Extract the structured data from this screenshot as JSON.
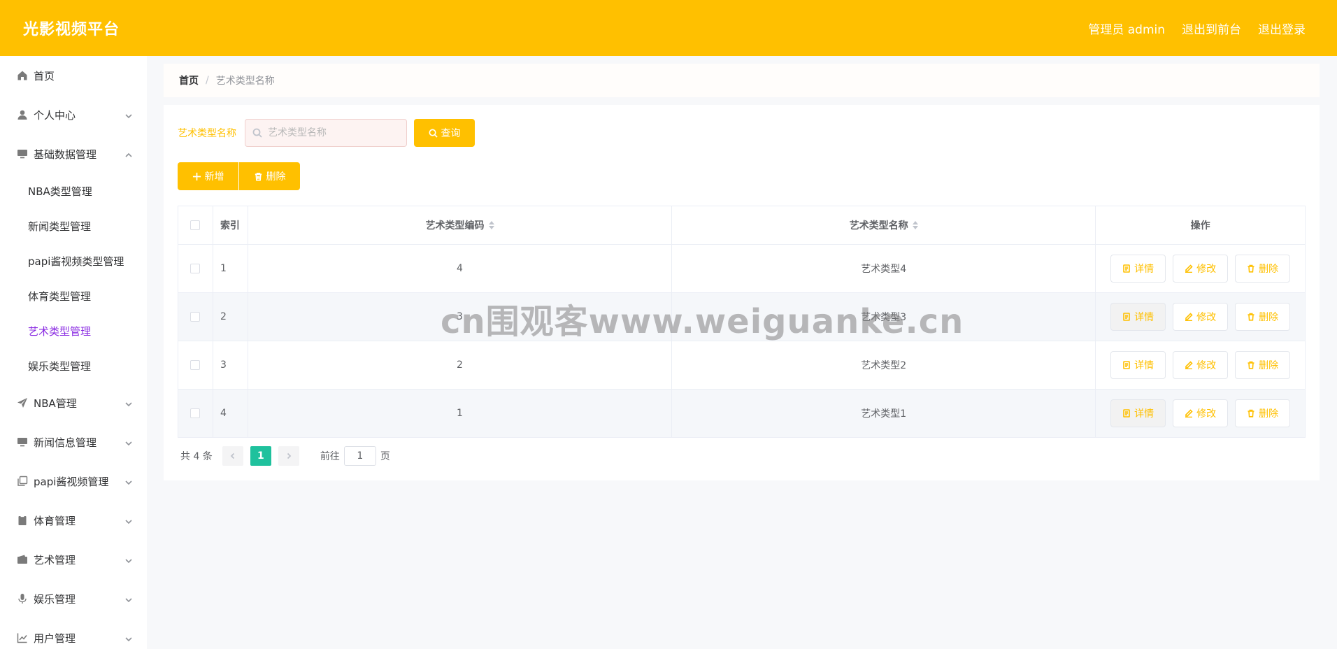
{
  "header": {
    "brand": "光影视频平台",
    "admin_label": "管理员 admin",
    "front_label": "退出到前台",
    "logout_label": "退出登录"
  },
  "sidebar": {
    "items": [
      {
        "label": "首页",
        "icon": "home-icon"
      },
      {
        "label": "个人中心",
        "icon": "user-icon"
      },
      {
        "label": "基础数据管理",
        "icon": "monitor-icon"
      },
      {
        "label": "NBA管理",
        "icon": "send-icon"
      },
      {
        "label": "新闻信息管理",
        "icon": "monitor-icon"
      },
      {
        "label": "papi酱视频管理",
        "icon": "copy-icon"
      },
      {
        "label": "体育管理",
        "icon": "clipboard-icon"
      },
      {
        "label": "艺术管理",
        "icon": "wallet-icon"
      },
      {
        "label": "娱乐管理",
        "icon": "microphone-icon"
      },
      {
        "label": "用户管理",
        "icon": "chart-icon"
      }
    ],
    "subitems": [
      {
        "label": "NBA类型管理"
      },
      {
        "label": "新闻类型管理"
      },
      {
        "label": "papi酱视频类型管理"
      },
      {
        "label": "体育类型管理"
      },
      {
        "label": "艺术类型管理"
      },
      {
        "label": "娱乐类型管理"
      }
    ]
  },
  "breadcrumb": {
    "home": "首页",
    "sep": "/",
    "current": "艺术类型名称"
  },
  "search": {
    "label": "艺术类型名称",
    "placeholder": "艺术类型名称",
    "button": "查询"
  },
  "actions": {
    "add": "新增",
    "delete": "删除"
  },
  "table": {
    "headers": {
      "index": "索引",
      "code": "艺术类型编码",
      "name": "艺术类型名称",
      "ops": "操作"
    },
    "rows": [
      {
        "index": "1",
        "code": "4",
        "name": "艺术类型4"
      },
      {
        "index": "2",
        "code": "3",
        "name": "艺术类型3"
      },
      {
        "index": "3",
        "code": "2",
        "name": "艺术类型2"
      },
      {
        "index": "4",
        "code": "1",
        "name": "艺术类型1"
      }
    ],
    "op_labels": {
      "detail": "详情",
      "edit": "修改",
      "delete": "删除"
    }
  },
  "pagination": {
    "total": "共 4 条",
    "current_page": "1",
    "goto_label": "前往",
    "goto_value": "1",
    "unit": "页"
  },
  "watermark": "cn围观客www.weiguanke.cn",
  "colors": {
    "accent": "#ffc000",
    "active_submenu": "#8a2be2",
    "pager_active": "#1fc19d"
  }
}
